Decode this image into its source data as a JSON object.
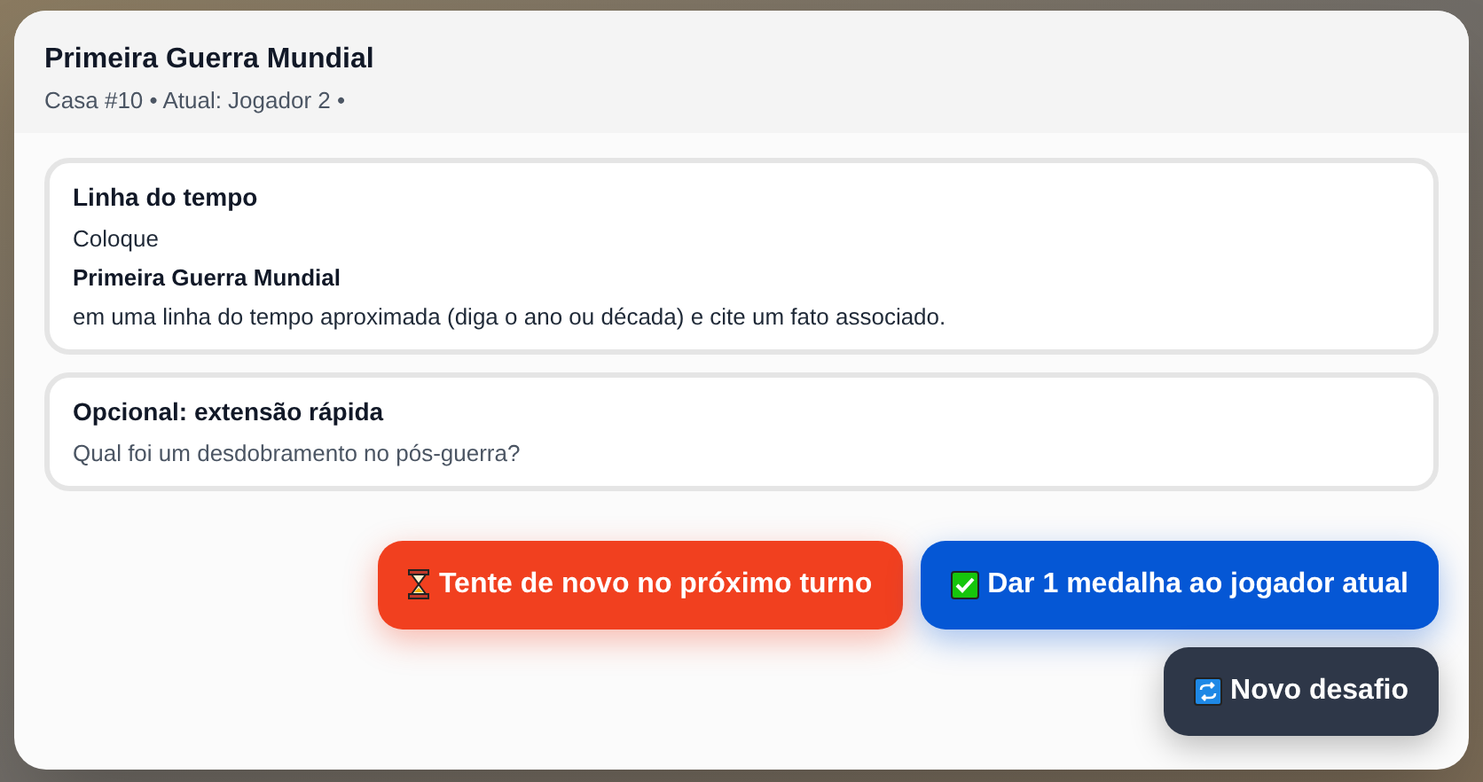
{
  "modal": {
    "title": "Primeira Guerra Mundial",
    "subtitle": "Casa #10 • Atual: Jogador 2 •"
  },
  "cards": [
    {
      "heading": "Linha do tempo",
      "lines": [
        {
          "text": "Coloque",
          "bold": false
        },
        {
          "text": "Primeira Guerra Mundial",
          "bold": true
        },
        {
          "text": "em uma linha do tempo aproximada (diga o ano ou década) e cite um fato associado.",
          "bold": false
        }
      ]
    },
    {
      "heading": "Opcional: extensão rápida",
      "lines": [
        {
          "text": "Qual foi um desdobramento no pós-guerra?",
          "bold": false,
          "muted": true
        }
      ]
    }
  ],
  "actions": [
    {
      "kind": "retry",
      "label": "Tente de novo no próximo turno"
    },
    {
      "kind": "award",
      "label": "Dar 1 medalha ao jogador atual"
    },
    {
      "kind": "new",
      "label": "Novo desafio"
    }
  ]
}
